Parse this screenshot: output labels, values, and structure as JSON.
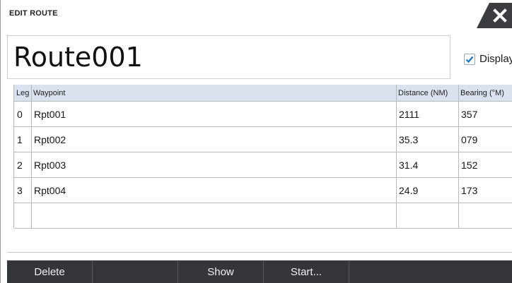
{
  "dialog": {
    "title": "EDIT ROUTE",
    "route_name": "Route001",
    "display_label": "Display",
    "display_checked": true
  },
  "table": {
    "columns": [
      "Leg",
      "Waypoint",
      "Distance (NM)",
      "Bearing (°M)"
    ],
    "rows": [
      {
        "leg": "0",
        "waypoint": "Rpt001",
        "distance": "2111",
        "bearing": "357"
      },
      {
        "leg": "1",
        "waypoint": "Rpt002",
        "distance": "35.3",
        "bearing": "079"
      },
      {
        "leg": "2",
        "waypoint": "Rpt003",
        "distance": "31.4",
        "bearing": "152"
      },
      {
        "leg": "3",
        "waypoint": "Rpt004",
        "distance": "24.9",
        "bearing": "173"
      }
    ]
  },
  "toolbar": {
    "delete": "Delete",
    "show": "Show",
    "start": "Start..."
  },
  "icons": {
    "close": "close-icon",
    "check": "checkmark-icon"
  },
  "colors": {
    "toolbar_bg": "#34363a",
    "header_bg": "#dbe2ef",
    "check_blue": "#1f6fd1"
  }
}
